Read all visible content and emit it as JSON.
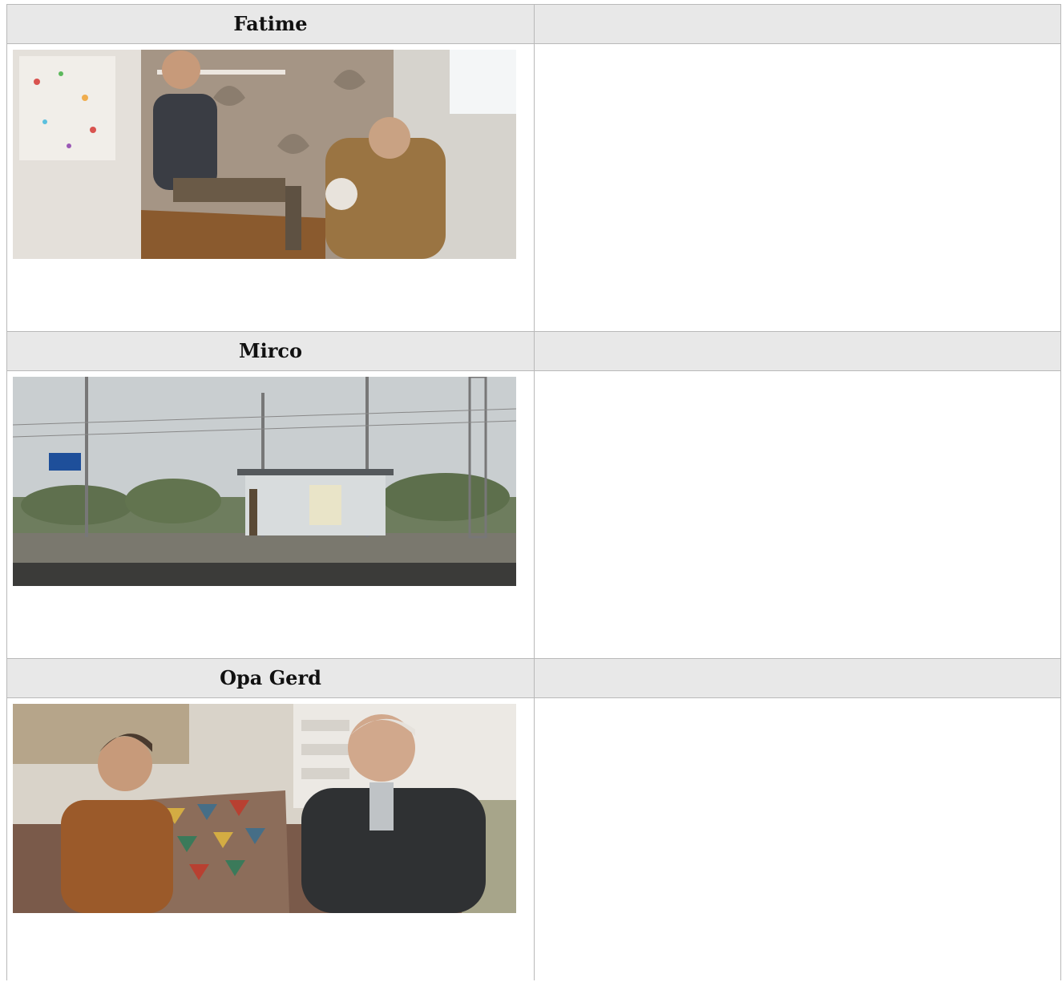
{
  "rows": [
    {
      "name": "Fatime",
      "photo": "film-still-fatime"
    },
    {
      "name": "Mirco",
      "photo": "film-still-mirco"
    },
    {
      "name": "Opa Gerd",
      "photo": "film-still-opa-gerd"
    }
  ],
  "colors": {
    "header_bg": "#e8e8e8",
    "border": "#b9b9b9"
  }
}
